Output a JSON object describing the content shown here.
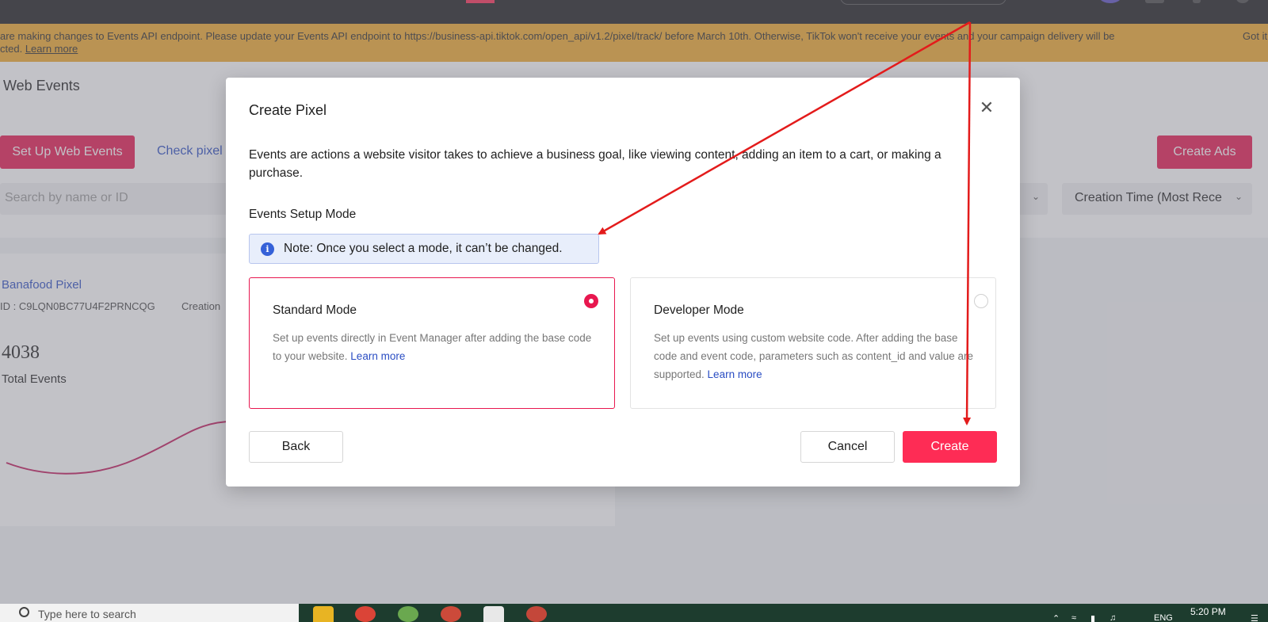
{
  "banner": {
    "message": "are making changes to Events API endpoint. Please update your Events API endpoint to https://business-api.tiktok.com/open_api/v1.2/pixel/track/ before March 10th. Otherwise, TikTok won't receive your events and your campaign delivery will be",
    "message_line2": "cted.",
    "learn_more": "Learn more",
    "got_it": "Got it"
  },
  "page": {
    "title": "Web Events",
    "setup_button": "Set Up Web Events",
    "check_pixel_link": "Check pixel",
    "create_ads_button": "Create Ads",
    "search_placeholder": "Search by name or ID",
    "sort_label": "Creation Time (Most Rece"
  },
  "pixel": {
    "name": "Banafood Pixel",
    "id": "ID : C9LQN0BC77U4F2PRNCQG",
    "creation_label": "Creation",
    "total_events_value": "4038",
    "total_events_label": "Total Events"
  },
  "modal": {
    "title": "Create Pixel",
    "description": "Events are actions a website visitor takes to achieve a business goal, like viewing content, adding an item to a cart, or making a purchase.",
    "setup_mode_label": "Events Setup Mode",
    "note": "Note: Once you select a mode, it can’t be changed.",
    "modes": [
      {
        "title": "Standard Mode",
        "description": "Set up events directly in Event Manager after adding the base code to your website. ",
        "learn_more": "Learn more",
        "selected": true
      },
      {
        "title": "Developer Mode",
        "description": "Set up events using custom website code. After adding the base code and event code, parameters such as content_id and value are supported. ",
        "learn_more": "Learn more",
        "selected": false
      }
    ],
    "back_button": "Back",
    "cancel_button": "Cancel",
    "create_button": "Create"
  },
  "taskbar": {
    "search_placeholder": "Type here to search",
    "time": "5:20 PM",
    "language": "ENG"
  },
  "colors": {
    "accent": "#fe2c55",
    "banner": "#f0a92c",
    "link": "#2a4dc3",
    "annotation": "#e31b1b"
  }
}
